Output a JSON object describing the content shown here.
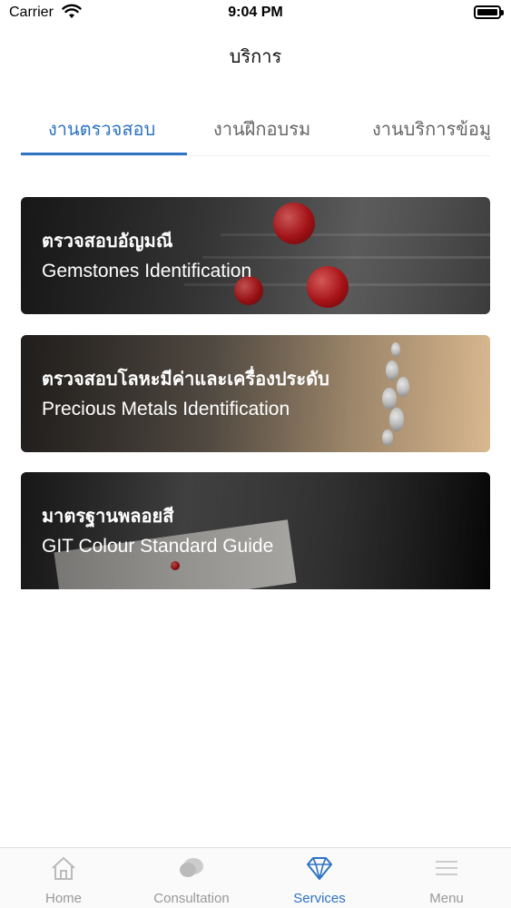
{
  "status_bar": {
    "carrier": "Carrier",
    "time": "9:04 PM"
  },
  "nav": {
    "title": "บริการ"
  },
  "tabs": [
    {
      "label": "งานตรวจสอบ",
      "active": true
    },
    {
      "label": "งานฝึกอบรม",
      "active": false
    },
    {
      "label": "งานบริการข้อมู",
      "active": false
    }
  ],
  "cards": [
    {
      "title_th": "ตรวจสอบอัญมณี",
      "title_en": "Gemstones Identification"
    },
    {
      "title_th": "ตรวจสอบโลหะมีค่าและเครื่องประดับ",
      "title_en": "Precious Metals Identification"
    },
    {
      "title_th": "มาตรฐานพลอยสี",
      "title_en": "GIT Colour Standard Guide"
    }
  ],
  "tabbar": {
    "items": [
      {
        "label": "Home",
        "icon": "home-icon",
        "active": false
      },
      {
        "label": "Consultation",
        "icon": "chat-bubble-icon",
        "active": false
      },
      {
        "label": "Services",
        "icon": "diamond-icon",
        "active": true
      },
      {
        "label": "Menu",
        "icon": "menu-icon",
        "active": false
      }
    ]
  },
  "colors": {
    "accent": "#2e73c4",
    "inactive": "#999999"
  }
}
